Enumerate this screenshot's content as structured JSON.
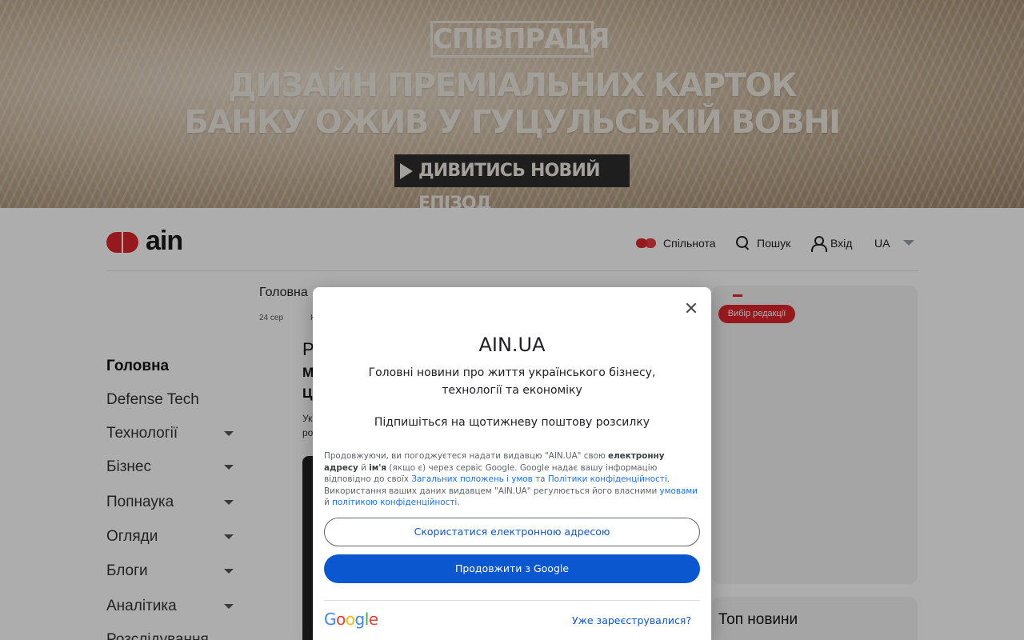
{
  "banner": {
    "tag": "СПІВПРАЦЯ",
    "headline_line1": "ДИЗАЙН ПРЕМІАЛЬНИХ КАРТОК",
    "headline_line2": "БАНКУ ОЖИВ У ГУЦУЛЬСЬКІЙ ВОВНІ",
    "cta": "ДИВИТИСЬ НОВИЙ ЕПІЗОД"
  },
  "header": {
    "logo_text": "ain",
    "community": "Спільнота",
    "search": "Пошук",
    "login": "Вхід",
    "language": "UA"
  },
  "sidebar": {
    "items": [
      {
        "label": "Головна",
        "active": true
      },
      {
        "label": "Defense Tech"
      },
      {
        "label": "Технології"
      },
      {
        "label": "Бізнес"
      },
      {
        "label": "Попнаука"
      },
      {
        "label": "Огляди"
      },
      {
        "label": "Блоги"
      },
      {
        "label": "Аналітика"
      },
      {
        "label": "Розслідування"
      }
    ]
  },
  "main": {
    "breadcrumb": "Головна",
    "date": "24 сер",
    "tag_initial": "Н",
    "title_initial": "Р",
    "line1_initial": "М",
    "line2_initial": "Ц",
    "lead1_initial": "Ук",
    "lead2_initial": "ро",
    "editor_pick": "Вибір редакції",
    "top_news": "Топ новини"
  },
  "modal": {
    "title": "AIN.UA",
    "subtitle": "Головні новини про життя українського бізнесу, технології та економіку",
    "subscribe": "Підпишіться на щотижневу поштову розсилку",
    "legal": {
      "p1": "Продовжуючи, ви погоджуєтеся надати видавцю \"AIN.UA\" свою ",
      "b1": "електронну адресу",
      "p2": " й ",
      "b2": "ім'я",
      "p3": " (якщо є) через сервіс Google. Google надає вашу інформацію відповідно до своїх ",
      "a1": "Загальних положень і умов",
      "p4": " та ",
      "a2": "Політики конфіденційності",
      "p5": ". Використання ваших даних видавцем \"AIN.UA\" регулюється його власними ",
      "a3": "умовами",
      "p6": " й ",
      "a4": "політикою конфіденційності",
      "p7": "."
    },
    "btn_email": "Скористатися електронною адресою",
    "btn_google": "Продовжити з Google",
    "google_logo": {
      "g": "G",
      "o1": "o",
      "o2": "o",
      "g2": "g",
      "l": "l",
      "e": "e"
    },
    "already": "Уже зареєструвалися?"
  },
  "colors": {
    "brand_red": "#e1262c",
    "google_blue": "#0b57d0"
  }
}
